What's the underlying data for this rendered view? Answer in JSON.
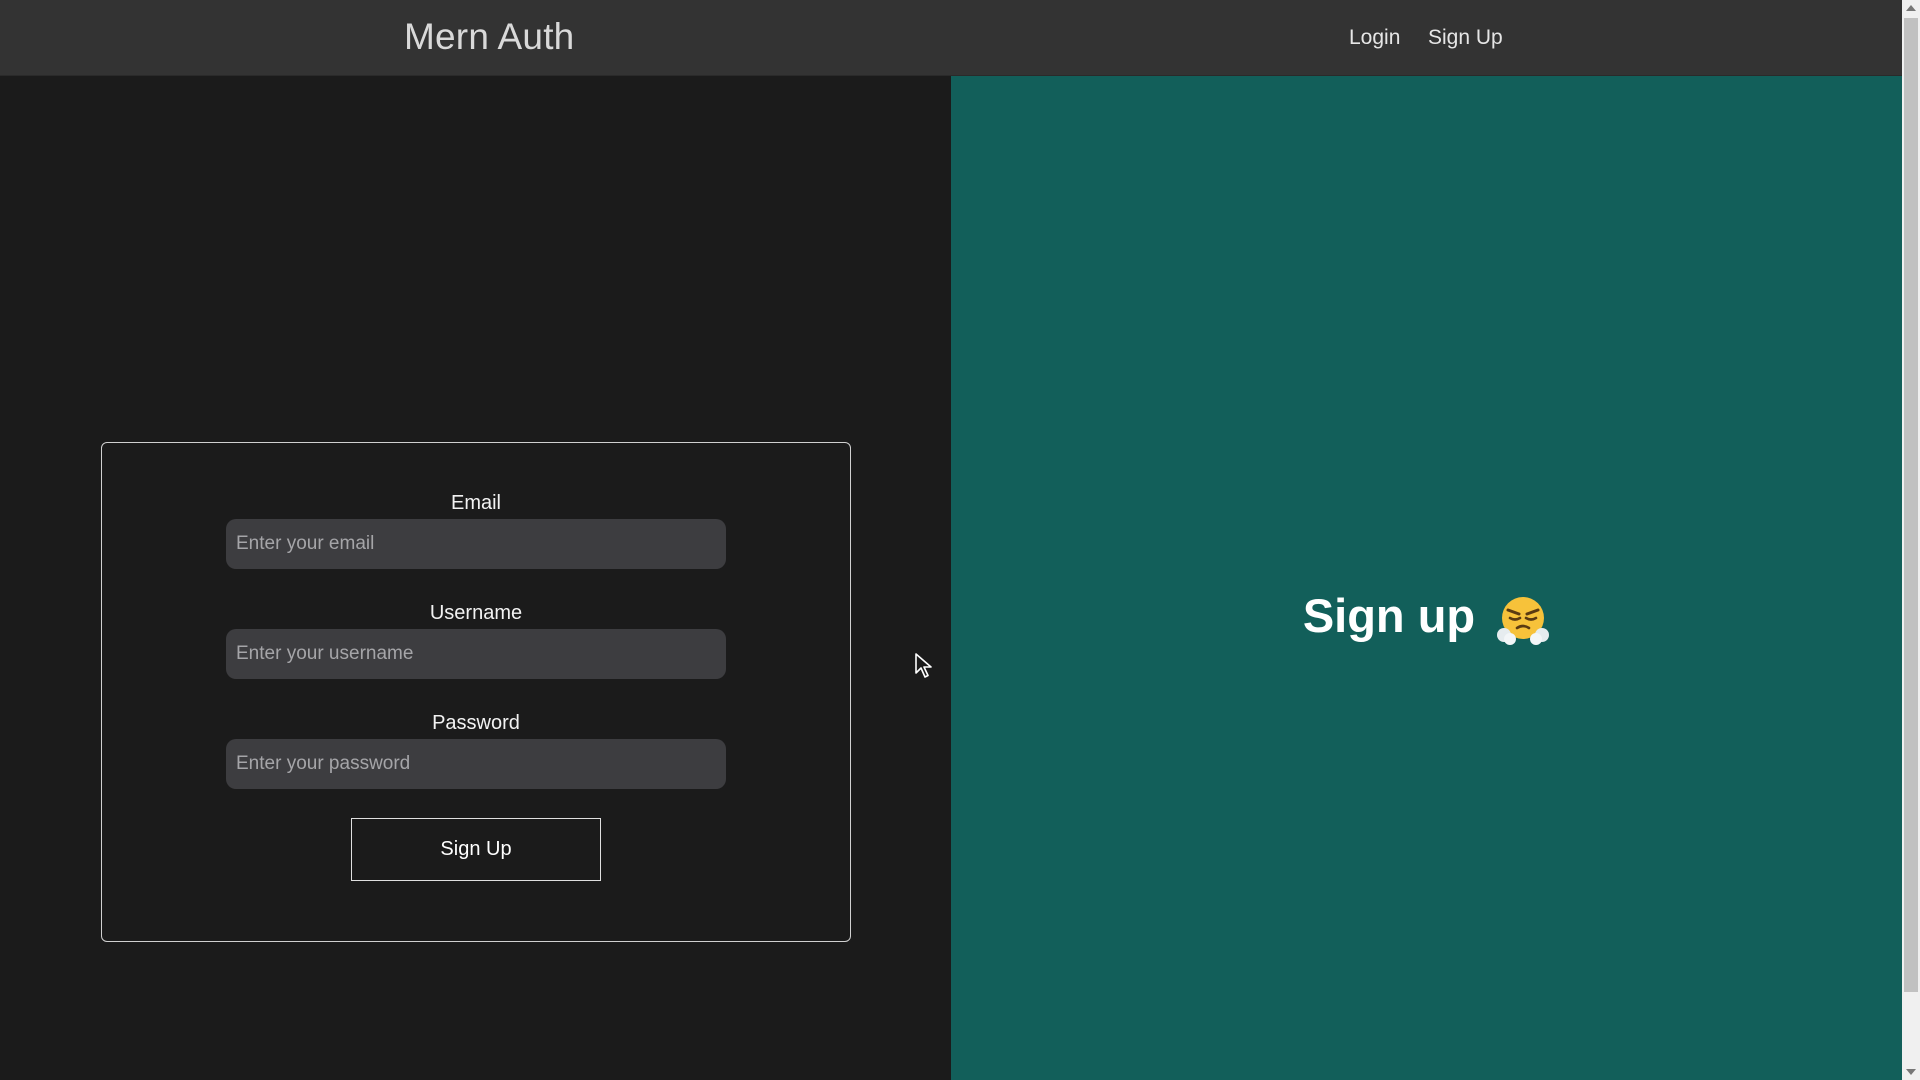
{
  "navbar": {
    "brand": "Mern Auth",
    "links": [
      {
        "label": "Login"
      },
      {
        "label": "Sign Up"
      }
    ]
  },
  "form": {
    "fields": [
      {
        "label": "Email",
        "placeholder": "Enter your email",
        "value": ""
      },
      {
        "label": "Username",
        "placeholder": "Enter your username",
        "value": ""
      },
      {
        "label": "Password",
        "placeholder": "Enter your password",
        "value": ""
      }
    ],
    "submit_label": "Sign Up"
  },
  "hero": {
    "text": "Sign up",
    "emoji_icon": "face-with-steam-from-nose-icon"
  },
  "colors": {
    "navbar_bg": "#333333",
    "left_bg": "#1b1b1b",
    "right_bg": "#125f5a",
    "input_bg": "#3d3d40"
  }
}
